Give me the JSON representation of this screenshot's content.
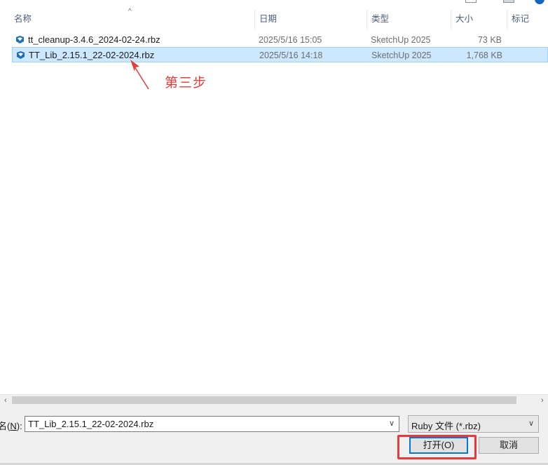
{
  "header": {
    "columns": [
      "名称",
      "日期",
      "类型",
      "大小",
      "标记"
    ],
    "sort_glyph": "^"
  },
  "files": [
    {
      "name": "tt_cleanup-3.4.6_2024-02-24.rbz",
      "date": "2025/5/16 15:05",
      "type": "SketchUp 2025",
      "size": "73 KB",
      "selected": false
    },
    {
      "name": "TT_Lib_2.15.1_22-02-2024.rbz",
      "date": "2025/5/16 14:18",
      "type": "SketchUp 2025",
      "size": "1,768 KB",
      "selected": true
    }
  ],
  "annotation": {
    "label": "第三步",
    "color": "#e8393b"
  },
  "filename_field": {
    "label_prefix": "名(",
    "label_key": "N",
    "label_suffix": "):",
    "value": "TT_Lib_2.15.1_22-02-2024.rbz"
  },
  "file_type_filter": {
    "value": "Ruby 文件 (*.rbz)"
  },
  "buttons": {
    "open": "打开(O)",
    "cancel": "取消"
  },
  "icons": {
    "file": "sketchup-file-icon",
    "dropdown": "chevron-down-icon",
    "scroll_left": "scroll-left-icon",
    "scroll_right": "scroll-right-icon"
  },
  "colors": {
    "selection_bg": "#cce8ff",
    "accent": "#0078d7",
    "annotation": "#e8393b"
  }
}
